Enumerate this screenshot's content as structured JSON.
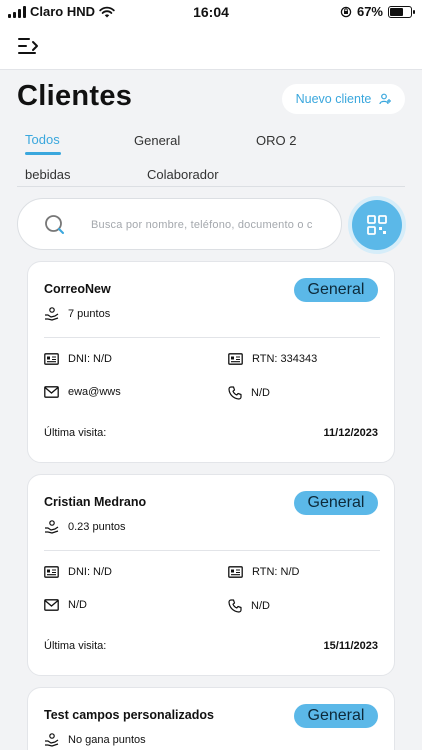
{
  "status": {
    "carrier": "Claro HND",
    "time": "16:04",
    "battery": "67%",
    "battery_level": 0.67
  },
  "page": {
    "title": "Clientes",
    "new_client_label": "Nuevo cliente"
  },
  "tabs": [
    {
      "label": "Todos",
      "active": true
    },
    {
      "label": "General",
      "active": false
    },
    {
      "label": "ORO 2",
      "active": false
    },
    {
      "label": "bebidas",
      "active": false
    },
    {
      "label": "Colaborador",
      "active": false
    }
  ],
  "search": {
    "placeholder": "Busca por nombre, teléfono, documento o c"
  },
  "labels": {
    "last_visit": "Última visita:"
  },
  "clients": [
    {
      "name": "CorreoNew",
      "badge": "General",
      "points": "7 puntos",
      "dni": "DNI: N/D",
      "rtn": "RTN: 334343",
      "email": "ewa@wws",
      "phone": "N/D",
      "last_visit": "11/12/2023"
    },
    {
      "name": "Cristian Medrano",
      "badge": "General",
      "points": "0.23 puntos",
      "dni": "DNI: N/D",
      "rtn": "RTN: N/D",
      "email": "N/D",
      "phone": "N/D",
      "last_visit": "15/11/2023"
    },
    {
      "name": "Test campos personalizados",
      "badge": "General",
      "points": "No gana puntos"
    }
  ],
  "colors": {
    "accent": "#3aa7dd",
    "badge": "#5bb8e8",
    "background": "#f2f3f5"
  }
}
